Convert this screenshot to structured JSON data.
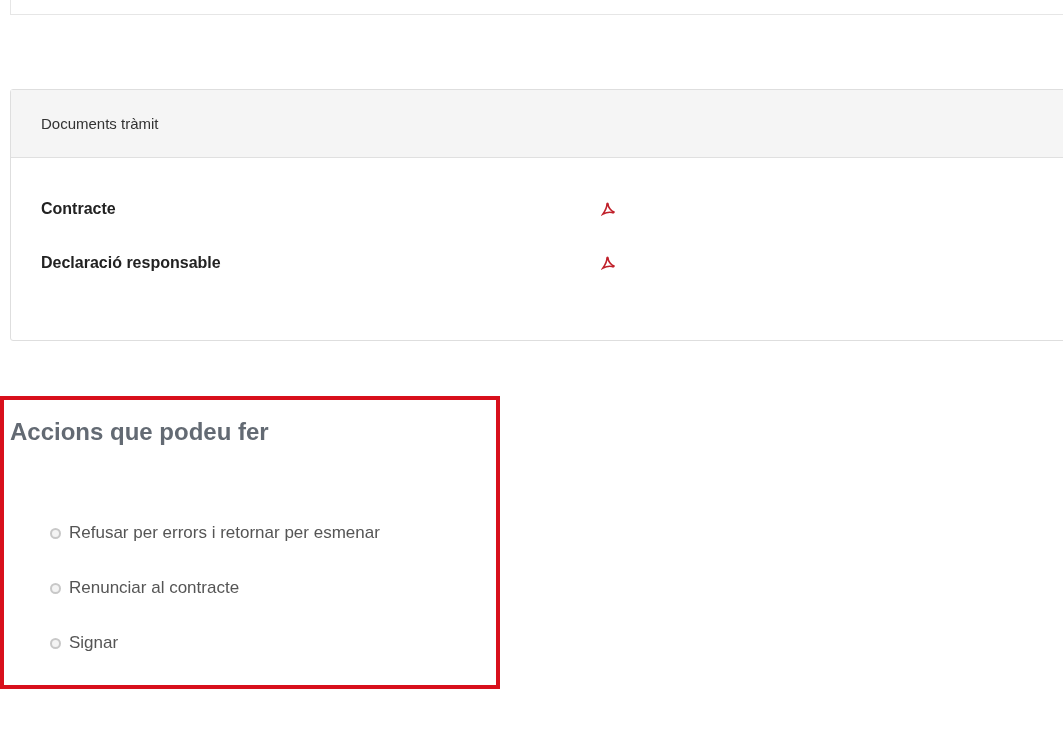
{
  "documents_panel": {
    "title": "Documents tràmit",
    "documents": [
      {
        "name": "Contracte"
      },
      {
        "name": "Declaració responsable"
      }
    ]
  },
  "actions": {
    "title": "Accions que podeu fer",
    "options": [
      {
        "label": "Refusar per errors i retornar per esmenar",
        "selected": false
      },
      {
        "label": "Renunciar al contracte",
        "selected": false
      },
      {
        "label": "Signar",
        "selected": false
      }
    ]
  }
}
